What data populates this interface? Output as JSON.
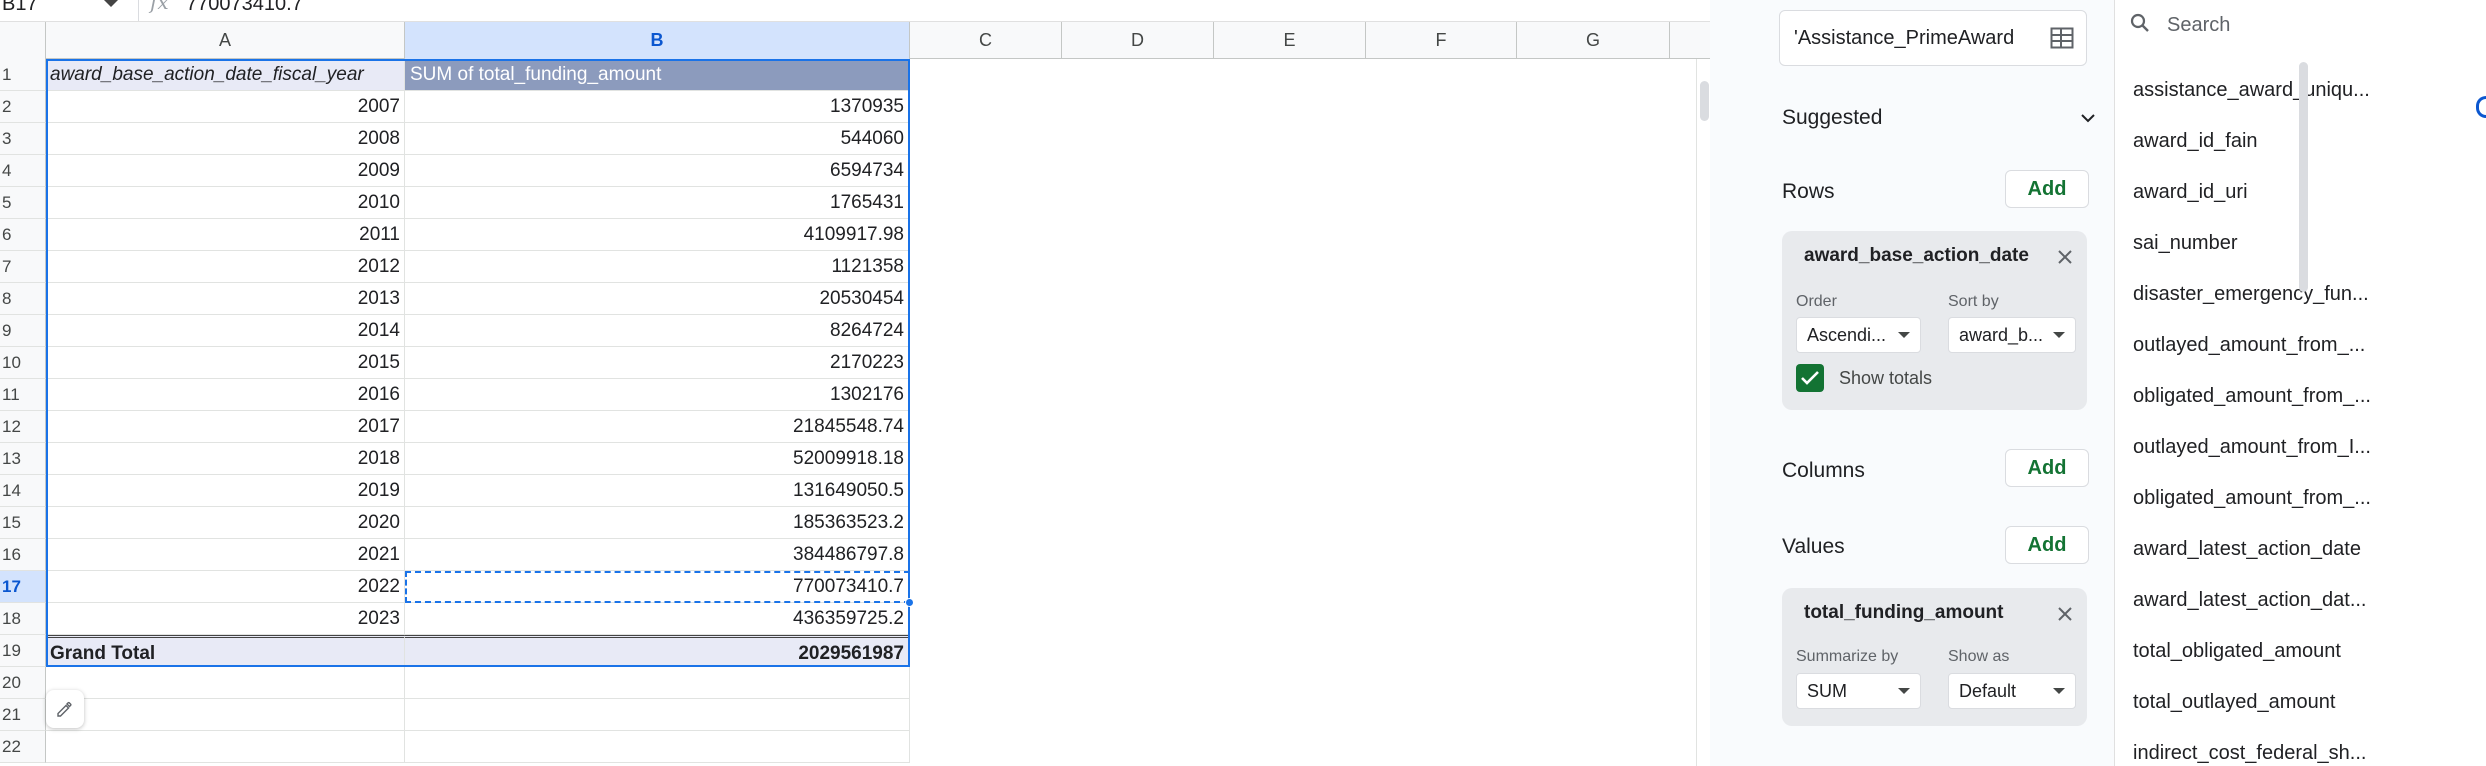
{
  "formula_bar": {
    "name_box": "B17",
    "fx": "fx",
    "value": "770073410.7"
  },
  "columns": [
    "A",
    "B",
    "C",
    "D",
    "E",
    "F",
    "G"
  ],
  "rows": [
    "1",
    "2",
    "3",
    "4",
    "5",
    "6",
    "7",
    "8",
    "9",
    "10",
    "11",
    "12",
    "13",
    "14",
    "15",
    "16",
    "17",
    "18",
    "19",
    "20",
    "21",
    "22"
  ],
  "pivot": {
    "header_a": "award_base_action_date_fiscal_year",
    "header_b": "SUM of total_funding_amount",
    "data": [
      {
        "year": "2007",
        "amount": "1370935"
      },
      {
        "year": "2008",
        "amount": "544060"
      },
      {
        "year": "2009",
        "amount": "6594734"
      },
      {
        "year": "2010",
        "amount": "1765431"
      },
      {
        "year": "2011",
        "amount": "4109917.98"
      },
      {
        "year": "2012",
        "amount": "1121358"
      },
      {
        "year": "2013",
        "amount": "20530454"
      },
      {
        "year": "2014",
        "amount": "8264724"
      },
      {
        "year": "2015",
        "amount": "2170223"
      },
      {
        "year": "2016",
        "amount": "1302176"
      },
      {
        "year": "2017",
        "amount": "21845548.74"
      },
      {
        "year": "2018",
        "amount": "52009918.18"
      },
      {
        "year": "2019",
        "amount": "131649050.5"
      },
      {
        "year": "2020",
        "amount": "185363523.2"
      },
      {
        "year": "2021",
        "amount": "384486797.8"
      },
      {
        "year": "2022",
        "amount": "770073410.7"
      },
      {
        "year": "2023",
        "amount": "436359725.2"
      }
    ],
    "grand_total_label": "Grand Total",
    "grand_total_value": "2029561987"
  },
  "editor": {
    "range": "'Assistance_PrimeAward",
    "suggested": "Suggested",
    "rows_label": "Rows",
    "columns_label": "Columns",
    "values_label": "Values",
    "add": "Add",
    "row_card": {
      "title": "award_base_action_date",
      "order_label": "Order",
      "order_value": "Ascendi...",
      "sort_label": "Sort by",
      "sort_value": "award_b...",
      "show_totals": "Show totals",
      "show_totals_checked": true
    },
    "value_card": {
      "title": "total_funding_amount",
      "summarize_label": "Summarize by",
      "summarize_value": "SUM",
      "show_as_label": "Show as",
      "show_as_value": "Default"
    }
  },
  "fields": {
    "search_placeholder": "Search",
    "items": [
      "assistance_award_uniqu...",
      "award_id_fain",
      "award_id_uri",
      "sai_number",
      "disaster_emergency_fun...",
      "outlayed_amount_from_...",
      "obligated_amount_from_...",
      "outlayed_amount_from_I...",
      "obligated_amount_from_...",
      "award_latest_action_date",
      "award_latest_action_dat...",
      "total_obligated_amount",
      "total_outlayed_amount",
      "indirect_cost_federal_sh..."
    ]
  },
  "colors": {
    "accent": "#1a73e8",
    "header_b_fill": "#8c9bbd",
    "add_text": "#137333"
  }
}
